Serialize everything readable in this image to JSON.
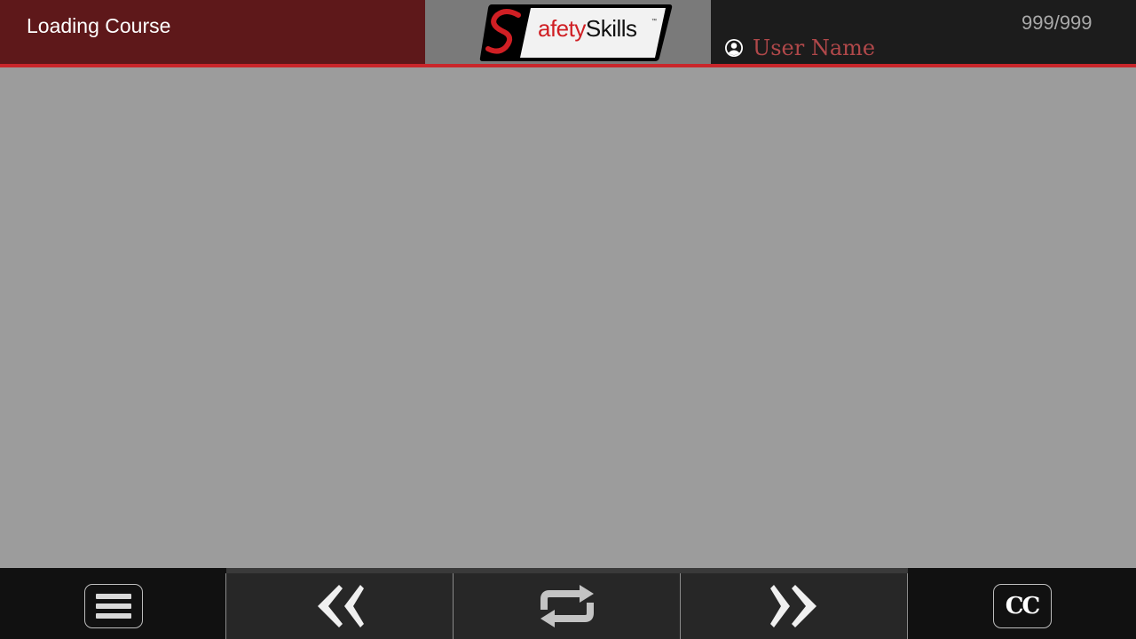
{
  "header": {
    "course_title": "Loading Course",
    "logo": {
      "text_s": "S",
      "text_afety": "afety",
      "text_skills": "Skills",
      "tm": "™",
      "brand_red": "#d01f24"
    },
    "page_counter": "999/999",
    "user": {
      "name": "User Name",
      "icon": "user-circle-icon"
    }
  },
  "footer": {
    "buttons": [
      {
        "name": "menu",
        "icon": "hamburger-menu-icon"
      },
      {
        "name": "back",
        "icon": "double-chevron-left-icon"
      },
      {
        "name": "replay",
        "icon": "repeat-icon"
      },
      {
        "name": "next",
        "icon": "double-chevron-right-icon"
      },
      {
        "name": "closed-captions",
        "icon": "cc-icon",
        "label": "CC"
      }
    ]
  },
  "colors": {
    "header_left": "#5e181a",
    "accent_red": "#c9262b",
    "content_bg": "#9c9c9c",
    "footer_dark": "#111111",
    "footer_mid": "#272727"
  }
}
